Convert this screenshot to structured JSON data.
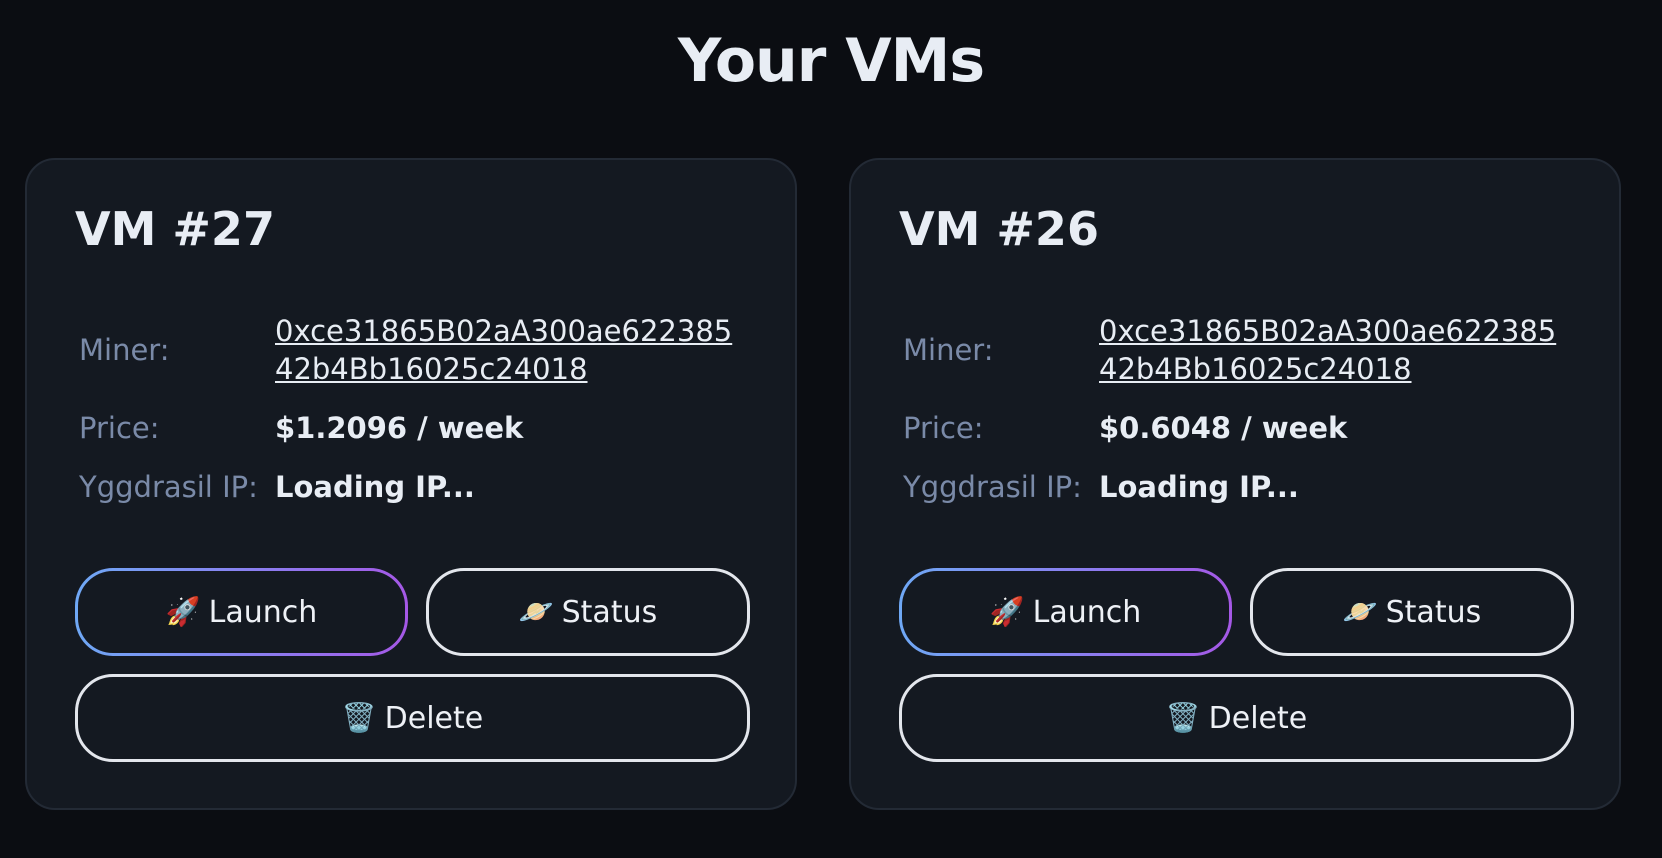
{
  "page": {
    "title": "Your VMs"
  },
  "vms": [
    {
      "title": "VM #27",
      "miner_label": "Miner:",
      "miner_value": "0xce31865B02aA300ae62238542b4Bb16025c24018",
      "price_label": "Price:",
      "price_value": "$1.2096 / week",
      "ip_label": "Yggdrasil IP:",
      "ip_value": "Loading IP...",
      "launch_icon": "🚀",
      "launch_label": "Launch",
      "status_icon": "🪐",
      "status_label": "Status",
      "delete_icon": "🗑️",
      "delete_label": "Delete"
    },
    {
      "title": "VM #26",
      "miner_label": "Miner:",
      "miner_value": "0xce31865B02aA300ae62238542b4Bb16025c24018",
      "price_label": "Price:",
      "price_value": "$0.6048 / week",
      "ip_label": "Yggdrasil IP:",
      "ip_value": "Loading IP...",
      "launch_icon": "🚀",
      "launch_label": "Launch",
      "status_icon": "🪐",
      "status_label": "Status",
      "delete_icon": "🗑️",
      "delete_label": "Delete"
    }
  ],
  "colors": {
    "background": "#0b0d12",
    "card": "#141921",
    "label": "#7a8aa8",
    "launch_gradient_start": "#6fa8f5",
    "launch_gradient_end": "#a558e6"
  },
  "icons": {
    "launch": "rocket-icon",
    "status": "planet-icon",
    "delete": "trash-icon"
  }
}
